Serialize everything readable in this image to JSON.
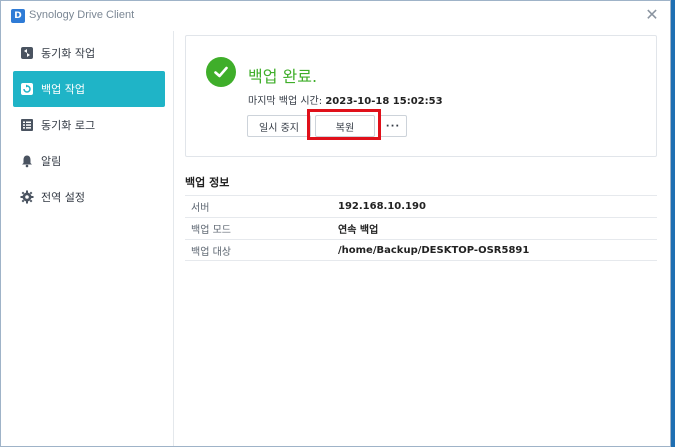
{
  "window": {
    "title": "Synology Drive Client",
    "app_icon_glyph": "D",
    "close_glyph": "✕"
  },
  "sidebar": {
    "items": [
      {
        "label": "동기화 작업",
        "icon": "sync-icon",
        "active": false
      },
      {
        "label": "백업 작업",
        "icon": "backup-icon",
        "active": true
      },
      {
        "label": "동기화 로그",
        "icon": "log-list-icon",
        "active": false
      },
      {
        "label": "알림",
        "icon": "bell-icon",
        "active": false
      },
      {
        "label": "전역 설정",
        "icon": "gear-icon",
        "active": false
      }
    ]
  },
  "status": {
    "title": "백업 완료.",
    "last_backup_label": "마지막 백업 시간:",
    "last_backup_value": "2023-10-18 15:02:53",
    "buttons": {
      "pause": "일시 중지",
      "restore": "복원",
      "more": "···"
    }
  },
  "info": {
    "heading": "백업 정보",
    "rows": [
      {
        "key": "서버",
        "value": "192.168.10.190"
      },
      {
        "key": "백업 모드",
        "value": "연속 백업"
      },
      {
        "key": "백업 대상",
        "value": "/home/Backup/DESKTOP-OSR5891"
      }
    ]
  },
  "colors": {
    "accent": "#1fb4c7",
    "success": "#3fae2a",
    "highlight": "#e0101a"
  }
}
